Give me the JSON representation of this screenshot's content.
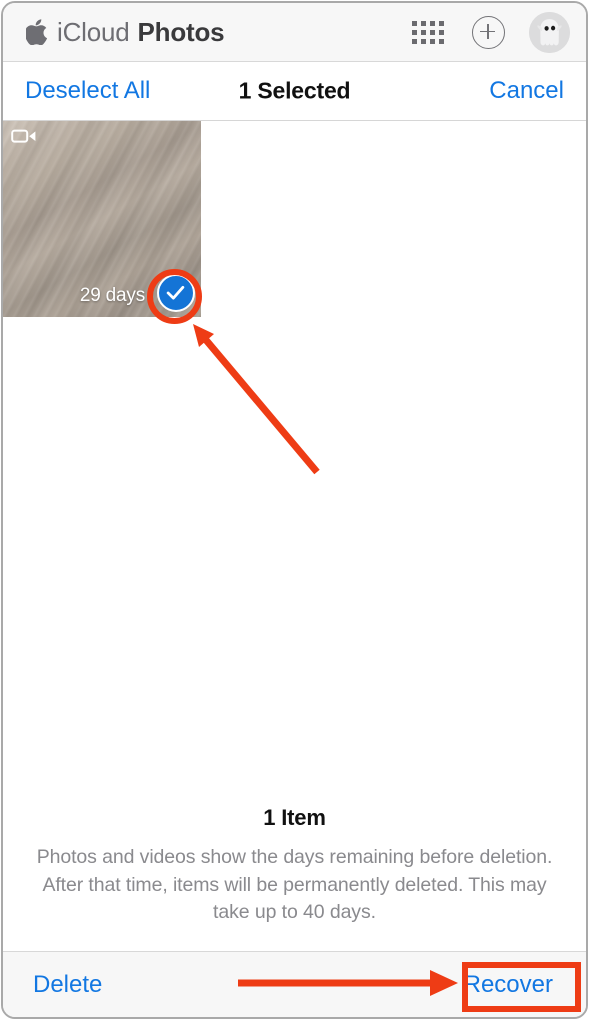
{
  "window": {
    "app_name": "iCloud Photos"
  },
  "toolbar": {
    "brand_icloud": "iCloud",
    "brand_photos": "Photos",
    "apple_logo_icon": "apple-logo-icon",
    "app_grid_icon": "app-grid-icon",
    "add_icon": "plus-circle-icon",
    "avatar_icon": "user-avatar-memoji"
  },
  "selection_bar": {
    "deselect_all": "Deselect All",
    "title": "1 Selected",
    "cancel": "Cancel"
  },
  "grid": {
    "items": [
      {
        "days_remaining": "29 days",
        "media_type_icon": "video-camera-icon",
        "selected": true,
        "check_icon": "checkmark-icon"
      }
    ]
  },
  "footer_info": {
    "item_count": "1 Item",
    "description": "Photos and videos show the days remaining before deletion. After that time, items will be permanently deleted. This may take up to 40 days."
  },
  "bottom_bar": {
    "delete_label": "Delete",
    "recover_label": "Recover"
  },
  "annotations": {
    "color": "#ee3c15",
    "highlight_check_circle": "red-ring-around-checkmark",
    "arrow_to_check": "red-arrow-pointing-to-checkmark",
    "arrow_to_recover": "red-arrow-pointing-to-recover",
    "highlight_recover": "red-box-around-recover"
  },
  "colors": {
    "accent_blue": "#1277e2",
    "check_blue": "#1474d6",
    "toolbar_bg": "#f7f7f7",
    "annotation_red": "#ee3c15",
    "muted_text": "#8a8a8e"
  }
}
